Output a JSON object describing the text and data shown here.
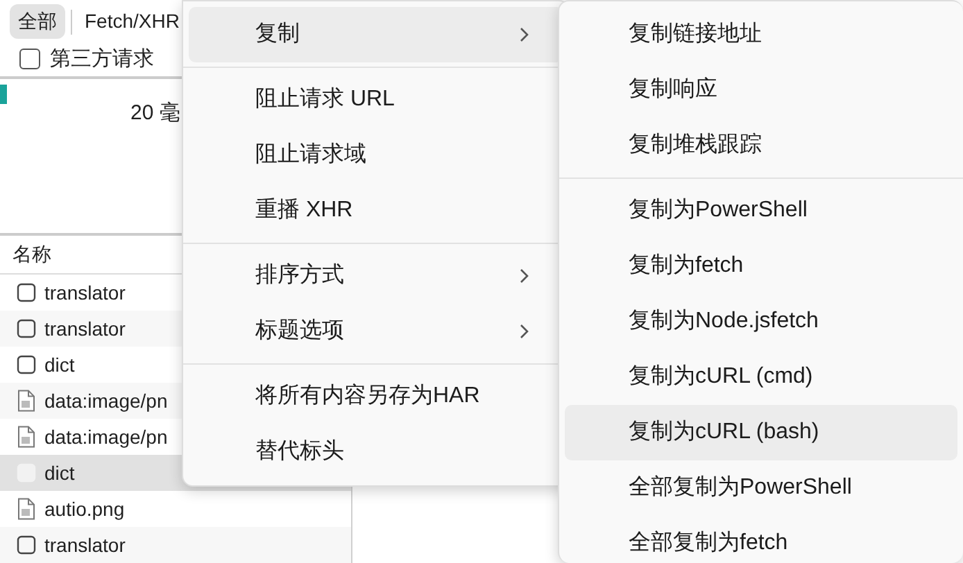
{
  "filter_tabs": [
    {
      "label": "全部",
      "selected": true
    },
    {
      "label": "Fetch/XHR",
      "selected": false
    }
  ],
  "third_party": {
    "label": "第三方请求",
    "checked": false
  },
  "overview": {
    "tick": "20 毫"
  },
  "name_column": "名称",
  "rows": [
    {
      "name": "translator",
      "kind": "doc",
      "selected": false
    },
    {
      "name": "translator",
      "kind": "doc",
      "selected": false
    },
    {
      "name": "dict",
      "kind": "doc",
      "selected": false
    },
    {
      "name": "data:image/pn",
      "kind": "image",
      "selected": false
    },
    {
      "name": "data:image/pn",
      "kind": "image",
      "selected": false
    },
    {
      "name": "dict",
      "kind": "doc",
      "selected": true
    },
    {
      "name": "autio.png",
      "kind": "image",
      "selected": false
    },
    {
      "name": "translator",
      "kind": "doc",
      "selected": false
    }
  ],
  "context_menu": {
    "groups": [
      [
        {
          "label": "复制",
          "has_submenu": true,
          "highlighted": true
        }
      ],
      [
        {
          "label": "阻止请求 URL",
          "has_submenu": false,
          "highlighted": false
        },
        {
          "label": "阻止请求域",
          "has_submenu": false,
          "highlighted": false
        },
        {
          "label": "重播 XHR",
          "has_submenu": false,
          "highlighted": false
        }
      ],
      [
        {
          "label": "排序方式",
          "has_submenu": true,
          "highlighted": false
        },
        {
          "label": "标题选项",
          "has_submenu": true,
          "highlighted": false
        }
      ],
      [
        {
          "label": "将所有内容另存为HAR",
          "has_submenu": false,
          "highlighted": false
        },
        {
          "label": "替代标头",
          "has_submenu": false,
          "highlighted": false
        }
      ]
    ]
  },
  "copy_submenu": {
    "groups": [
      [
        {
          "label": "复制链接地址",
          "highlighted": false
        },
        {
          "label": "复制响应",
          "highlighted": false
        },
        {
          "label": "复制堆栈跟踪",
          "highlighted": false
        }
      ],
      [
        {
          "label": "复制为PowerShell",
          "highlighted": false
        },
        {
          "label": "复制为fetch",
          "highlighted": false
        },
        {
          "label": "复制为Node.jsfetch",
          "highlighted": false
        },
        {
          "label": "复制为cURL (cmd)",
          "highlighted": false
        },
        {
          "label": "复制为cURL (bash)",
          "highlighted": true
        },
        {
          "label": "全部复制为PowerShell",
          "highlighted": false
        },
        {
          "label": "全部复制为fetch",
          "highlighted": false
        }
      ]
    ]
  }
}
